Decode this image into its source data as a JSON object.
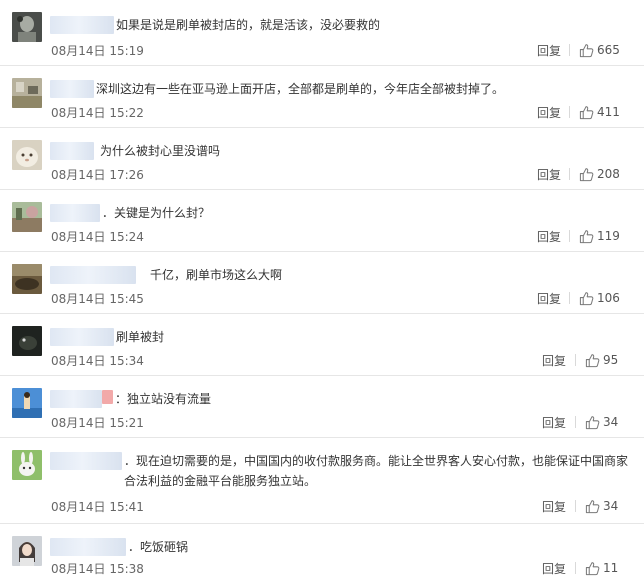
{
  "ui": {
    "reply_label": "回复"
  },
  "comments": [
    {
      "text": "如果是说是刷单被封店的，就是活该，没必要救的",
      "time": "08月14日 15:19",
      "likes": "665"
    },
    {
      "text": "深圳这边有一些在亚马逊上面开店，全部都是刷单的，今年店全部被封掉了。",
      "time": "08月14日 15:22",
      "likes": "411"
    },
    {
      "text": "为什么被封心里没谱吗",
      "time": "08月14日 17:26",
      "likes": "208"
    },
    {
      "text": "．关键是为什么封？",
      "time": "08月14日 15:24",
      "likes": "119"
    },
    {
      "text": "千亿，刷单市场这么大啊",
      "time": "08月14日 15:45",
      "likes": "106"
    },
    {
      "text": "刷单被封",
      "time": "08月14日 15:34",
      "likes": "95"
    },
    {
      "text": "：独立站没有流量",
      "time": "08月14日 15:21",
      "likes": "34"
    },
    {
      "text": "．现在迫切需要的是，中国国内的收付款服务商。能让全世界客人安心付款，也能保证中国商家合法利益的金融平台能服务独立站。",
      "time": "08月14日 15:41",
      "likes": "34"
    },
    {
      "text": "．吃饭砸锅",
      "time": "08月14日 15:38",
      "likes": "11"
    }
  ]
}
